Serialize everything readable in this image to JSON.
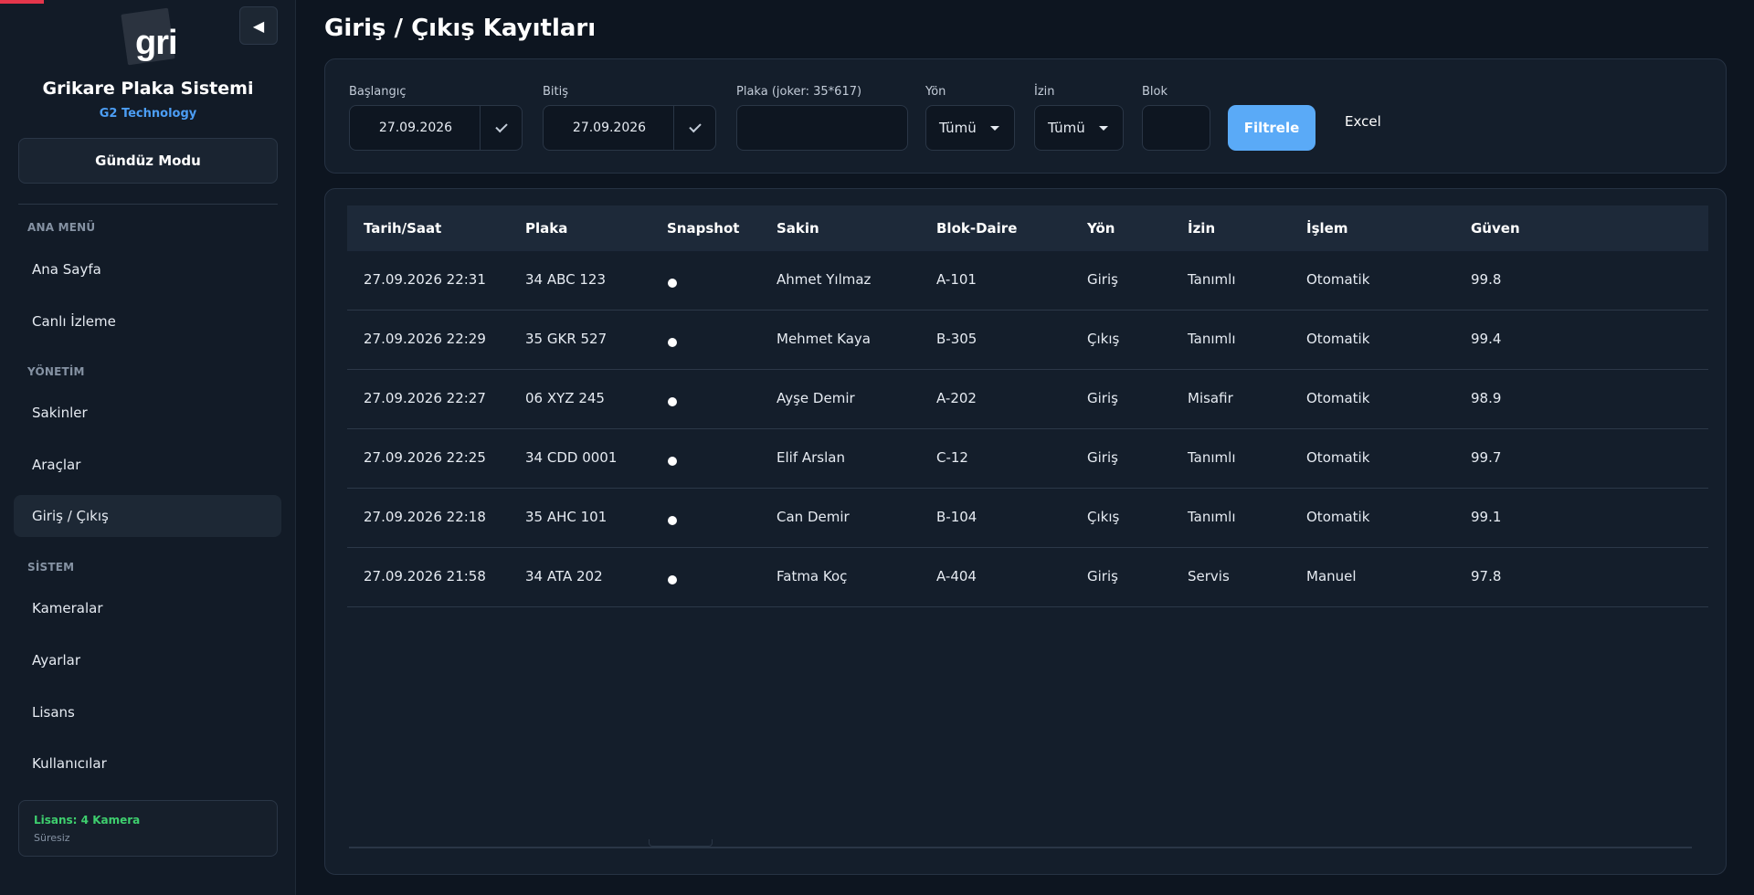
{
  "sidebar": {
    "logo_text": "gri",
    "collapse_icon": "◀",
    "app_title": "Grikare Plaka Sistemi",
    "app_subtitle": "G2 Technology",
    "mode_button": "Gündüz Modu",
    "sections": {
      "main": "ANA MENÜ",
      "management": "YÖNETİM",
      "system": "SİSTEM"
    },
    "items": {
      "home": "Ana Sayfa",
      "live": "Canlı İzleme",
      "residents": "Sakinler",
      "vehicles": "Araçlar",
      "entry_exit": "Giriş / Çıkış",
      "cameras": "Kameralar",
      "settings": "Ayarlar",
      "license": "Lisans",
      "users": "Kullanıcılar"
    },
    "active_item": "Giriş / Çıkış",
    "license_box": {
      "title": "Lisans: 4 Kamera",
      "subtitle": "Süresiz"
    }
  },
  "page": {
    "title": "Giriş / Çıkış Kayıtları"
  },
  "filters": {
    "start_label": "Başlangıç",
    "start_value": "27.09.2026",
    "end_label": "Bitiş",
    "end_value": "27.09.2026",
    "plate_label": "Plaka (joker: 35*617)",
    "plate_value": "",
    "direction_label": "Yön",
    "direction_value": "Tümü",
    "permission_label": "İzin",
    "permission_value": "Tümü",
    "block_label": "Blok",
    "block_value": "",
    "filter_button": "Filtrele",
    "excel_button": "Excel"
  },
  "table": {
    "headers": {
      "datetime": "Tarih/Saat",
      "plate": "Plaka",
      "snapshot": "Snapshot",
      "resident": "Sakin",
      "block_apt": "Blok-Daire",
      "direction": "Yön",
      "permission": "İzin",
      "process": "İşlem",
      "confidence": "Güven"
    },
    "rows": [
      {
        "datetime": "27.09.2026 22:31",
        "plate": "34 ABC 123",
        "resident": "Ahmet Yılmaz",
        "block_apt": "A-101",
        "direction": "Giriş",
        "permission": "Tanımlı",
        "process": "Otomatik",
        "confidence": "99.8"
      },
      {
        "datetime": "27.09.2026 22:29",
        "plate": "35 GKR 527",
        "resident": "Mehmet Kaya",
        "block_apt": "B-305",
        "direction": "Çıkış",
        "permission": "Tanımlı",
        "process": "Otomatik",
        "confidence": "99.4"
      },
      {
        "datetime": "27.09.2026 22:27",
        "plate": "06 XYZ 245",
        "resident": "Ayşe Demir",
        "block_apt": "A-202",
        "direction": "Giriş",
        "permission": "Misafir",
        "process": "Otomatik",
        "confidence": "98.9"
      },
      {
        "datetime": "27.09.2026 22:25",
        "plate": "34 CDD 0001",
        "resident": "Elif Arslan",
        "block_apt": "C-12",
        "direction": "Giriş",
        "permission": "Tanımlı",
        "process": "Otomatik",
        "confidence": "99.7"
      },
      {
        "datetime": "27.09.2026 22:18",
        "plate": "35 AHC 101",
        "resident": "Can Demir",
        "block_apt": "B-104",
        "direction": "Çıkış",
        "permission": "Tanımlı",
        "process": "Otomatik",
        "confidence": "99.1"
      },
      {
        "datetime": "27.09.2026 21:58",
        "plate": "34 ATA 202",
        "resident": "Fatma Koç",
        "block_apt": "A-404",
        "direction": "Giriş",
        "permission": "Servis",
        "process": "Manuel",
        "confidence": "97.8"
      }
    ]
  },
  "colors": {
    "accent": "#5aaaf7",
    "brand_subtitle": "#4c9ef5",
    "license_green": "#3ecf6e",
    "top_accent_red": "#e5364b"
  }
}
